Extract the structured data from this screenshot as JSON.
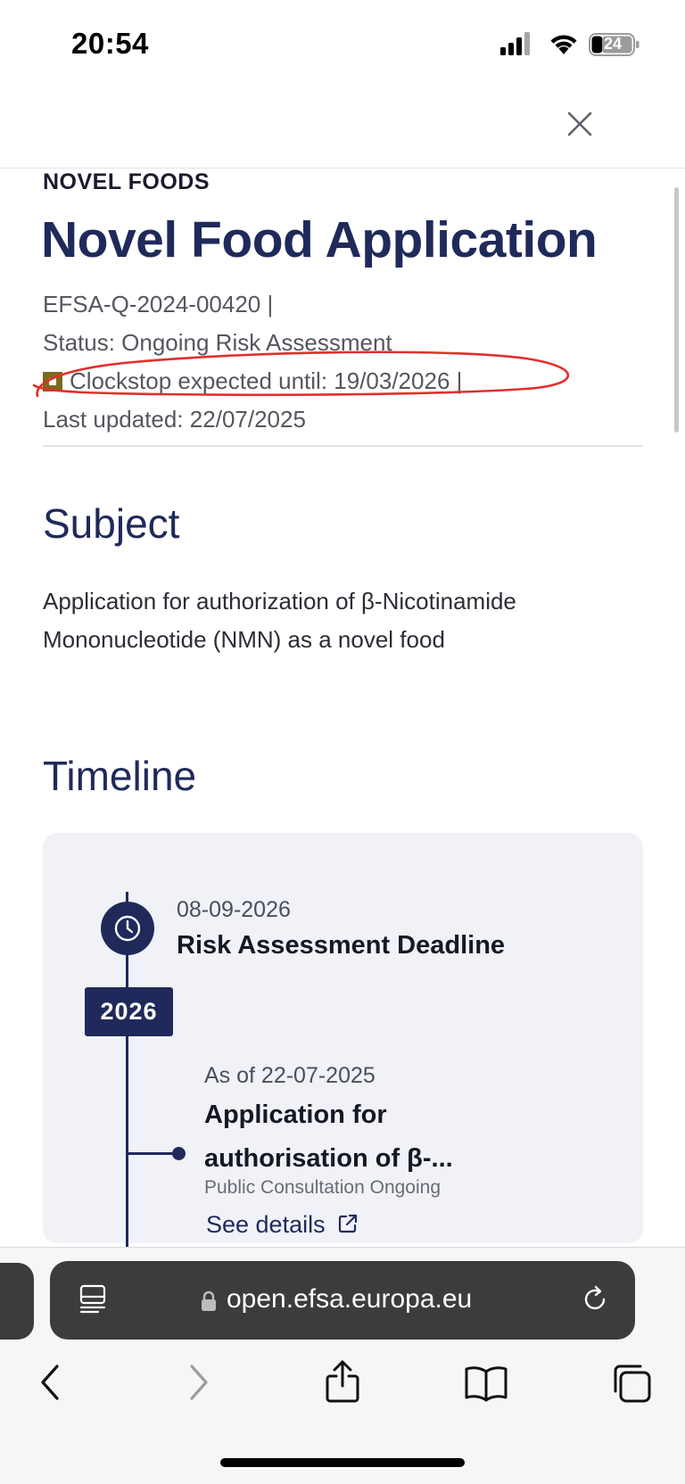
{
  "status_bar": {
    "time": "20:54",
    "battery": "24"
  },
  "header": {
    "close_icon": "close-icon"
  },
  "page": {
    "kicker": "NOVEL FOODS",
    "title": "Novel Food Application",
    "meta": {
      "reference": "EFSA-Q-2024-00420 |",
      "status": "Status: Ongoing Risk Assessment",
      "clockstop": "Clockstop expected until: 19/03/2026 |",
      "last_updated": "Last updated: 22/07/2025"
    },
    "subject_heading": "Subject",
    "subject_text": "Application for authorization of β-Nicotinamide Mononucleotide (NMN) as a novel food",
    "timeline_heading": "Timeline"
  },
  "timeline": {
    "year": "2026",
    "events": [
      {
        "date": "08-09-2026",
        "title": "Risk Assessment Deadline"
      },
      {
        "date": "As of 22-07-2025",
        "title": "Application for authorisation of β-...",
        "subtitle": "Public Consultation Ongoing",
        "link": "See details"
      }
    ]
  },
  "browser": {
    "url": "open.efsa.europa.eu"
  },
  "colors": {
    "navy": "#1f2a5a",
    "annotation": "#e0302a",
    "clockstop_square": "#7a6a1e"
  }
}
